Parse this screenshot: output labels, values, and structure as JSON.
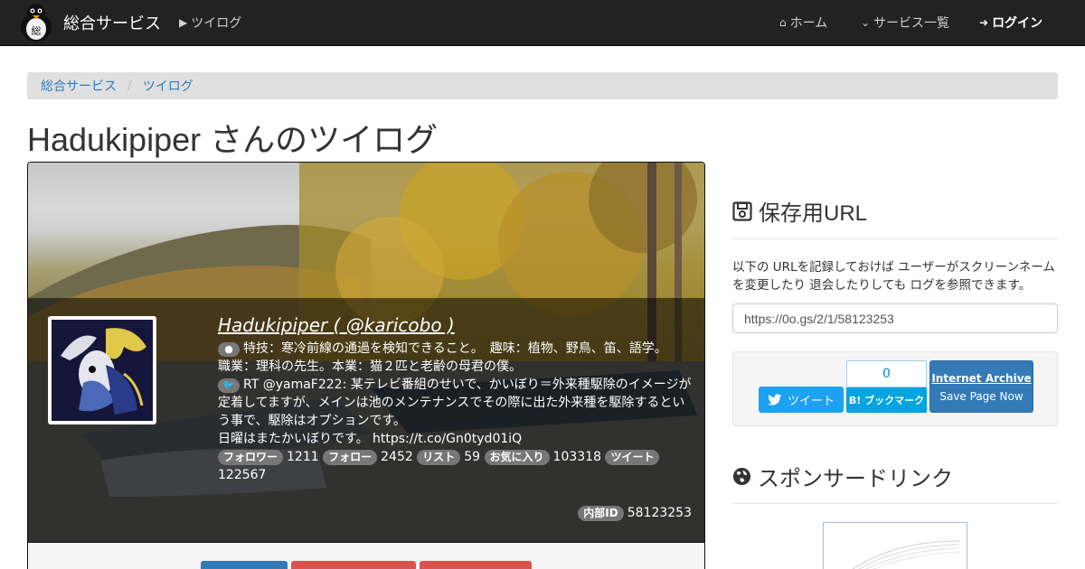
{
  "navbar": {
    "brand": "総合サービス",
    "sub_link": "ツイログ",
    "home": "ホーム",
    "services": "サービス一覧",
    "login": "ログイン"
  },
  "breadcrumb": [
    "総合サービス",
    "ツイログ"
  ],
  "page_title": "Hadukipiper さんのツイログ",
  "profile": {
    "name": "Hadukipiper ( @karicobo )",
    "bio_line1": "特技：寒冷前線の通過を検知できること。　趣味：植物、野鳥、笛、語学。",
    "bio_line2": "職業：理科の先生。本業：猫２匹と老齢の母君の僕。",
    "tweet_text": "RT @yamaF222: 某テレビ番組のせいで、かいぼり＝外来種駆除のイメージが定着してますが、メインは池のメンテナンスでその際に出た外来種を駆除するという事で、駆除はオプションです。",
    "tweet_line2": "日曜はまたかいぼりです。 https://t.co/Gn0tyd01iQ",
    "stats": [
      {
        "label": "フォロワー",
        "value": "1211"
      },
      {
        "label": "フォロー",
        "value": "2452"
      },
      {
        "label": "リスト",
        "value": "59"
      },
      {
        "label": "お気に入り",
        "value": "103318"
      },
      {
        "label": "ツイート",
        "value": "122567"
      }
    ],
    "internal_id_label": "内部ID",
    "internal_id": "58123253"
  },
  "sidebar": {
    "save_title": "保存用URL",
    "save_desc": "以下の URLを記録しておけば ユーザーがスクリーンネームを変更したり 退会したりしても ログを参照できます。",
    "url": "https://0o.gs/2/1/58123253",
    "tweet_btn": "ツイート",
    "hatena_count": "0",
    "hatena_btn": "B! ブックマーク",
    "ia_title": "Internet Archive",
    "ia_sub": "Save Page Now",
    "sponsor_title": "スポンサードリンク"
  },
  "colors": {
    "navbar": "#222222",
    "link": "#337ab7",
    "twitter": "#1da1f2",
    "hatena": "#00a4de",
    "ia_button": "#337ab7"
  }
}
